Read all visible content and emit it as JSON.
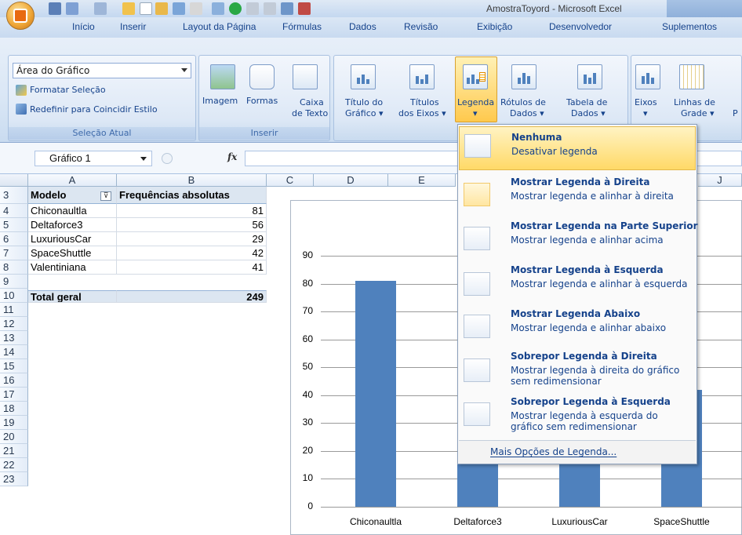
{
  "window": {
    "title": "AmostraToyord - Microsoft Excel"
  },
  "tabs": [
    "Início",
    "Inserir",
    "Layout da Página",
    "Fórmulas",
    "Dados",
    "Revisão",
    "Exibição",
    "Desenvolvedor",
    "Suplementos"
  ],
  "ribbon": {
    "selecao_atual": {
      "dropdown_value": "Área do Gráfico",
      "formatar": "Formatar Seleção",
      "redefinir": "Redefinir para Coincidir Estilo",
      "label": "Seleção Atual"
    },
    "inserir": {
      "imagem": "Imagem",
      "formas": "Formas",
      "caixa_texto_1": "Caixa",
      "caixa_texto_2": "de Texto",
      "label": "Inserir"
    },
    "rotulos": {
      "titulo_grafico_1": "Título do",
      "titulo_grafico_2": "Gráfico ▾",
      "titulos_eixos_1": "Títulos",
      "titulos_eixos_2": "dos Eixos ▾",
      "legenda": "Legenda",
      "rotulos_dados_1": "Rótulos de",
      "rotulos_dados_2": "Dados ▾",
      "tabela_dados_1": "Tabela de",
      "tabela_dados_2": "Dados ▾"
    },
    "eixos": {
      "eixos": "Eixos",
      "linhas_grade_1": "Linhas de",
      "linhas_grade_2": "Grade ▾",
      "p": "P"
    }
  },
  "formula_bar": {
    "name_box": "Gráfico 1",
    "fx": "fx"
  },
  "columns": [
    "A",
    "B",
    "C",
    "D",
    "E",
    "J"
  ],
  "rows": [
    "3",
    "4",
    "5",
    "6",
    "7",
    "8",
    "9",
    "10",
    "11",
    "12",
    "13",
    "14",
    "15",
    "16",
    "17",
    "18",
    "19",
    "20",
    "21",
    "22",
    "23"
  ],
  "table": {
    "header": [
      "Modelo",
      "Frequências absolutas"
    ],
    "rows": [
      [
        "Chiconaultla",
        "81"
      ],
      [
        "Deltaforce3",
        "56"
      ],
      [
        "LuxuriousCar",
        "29"
      ],
      [
        "SpaceShuttle",
        "42"
      ],
      [
        "Valentiniana",
        "41"
      ]
    ],
    "total": [
      "Total geral",
      "249"
    ]
  },
  "chart_data": {
    "type": "bar",
    "categories": [
      "Chiconaultla",
      "Deltaforce3",
      "LuxuriousCar",
      "SpaceShuttle"
    ],
    "values": [
      81,
      56,
      29,
      42
    ],
    "ylim": [
      0,
      90
    ],
    "yticks": [
      "0",
      "10",
      "20",
      "30",
      "40",
      "50",
      "60",
      "70",
      "80",
      "90"
    ],
    "grid": true,
    "colors": {
      "bar": "#4f81bd"
    }
  },
  "legend_menu": {
    "items": [
      {
        "title": "Nenhuma",
        "desc": "Desativar legenda"
      },
      {
        "title": "Mostrar Legenda à Direita",
        "desc": "Mostrar legenda e alinhar à direita"
      },
      {
        "title": "Mostrar Legenda na Parte Superior",
        "desc": "Mostrar legenda e alinhar acima"
      },
      {
        "title": "Mostrar Legenda à Esquerda",
        "desc": "Mostrar legenda e alinhar à esquerda"
      },
      {
        "title": "Mostrar Legenda Abaixo",
        "desc": "Mostrar legenda e alinhar abaixo"
      },
      {
        "title": "Sobrepor Legenda à Direita",
        "desc": "Mostrar legenda à direita do gráfico sem redimensionar"
      },
      {
        "title": "Sobrepor Legenda à Esquerda",
        "desc": "Mostrar legenda à esquerda do gráfico sem redimensionar"
      }
    ],
    "more_options": "Mais Opções de Legenda..."
  }
}
